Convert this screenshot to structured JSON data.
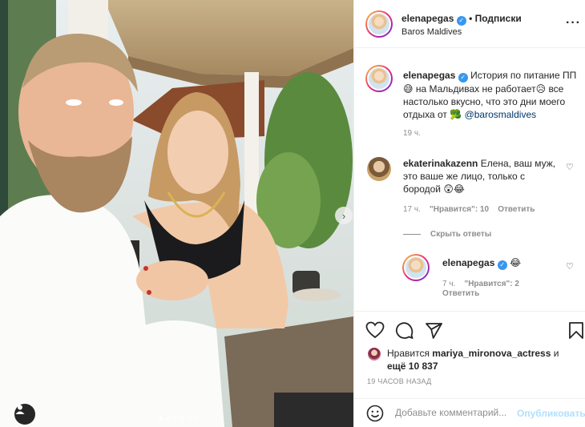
{
  "header": {
    "username": "elenapegas",
    "separator": "•",
    "follow_label": "Подписки",
    "location": "Baros Maldives",
    "more_icon": "more-horizontal-icon"
  },
  "caption": {
    "username": "elenapegas",
    "text_1": "История по питание ПП",
    "emoji_1": "😅",
    "text_2": "на Мальдивах не работает",
    "emoji_2": "😥",
    "text_3": "все настолько вкусно, что это дни моего отдыха от",
    "emoji_3": "🥦",
    "mention": "@barosmaldives",
    "time": "19 ч."
  },
  "comment": {
    "username": "ekaterinakazenn",
    "text_1": "Елена, ваш муж, это ваше же лицо, только с бородой",
    "emoji": "😲😂",
    "time": "17 ч.",
    "likes": "\"Нравится\": 10",
    "reply_label": "Ответить"
  },
  "hide_replies_label": "Скрыть ответы",
  "reply": {
    "username": "elenapegas",
    "emoji": "😂",
    "time": "7 ч.",
    "likes": "\"Нравится\": 2",
    "reply_label": "Ответить"
  },
  "likes_row": {
    "prefix": "Нравится",
    "user": "mariya_mironova_actress",
    "conjunction": "и",
    "more": "ещё 10 837"
  },
  "date": "19 ЧАСОВ НАЗАД",
  "add_comment": {
    "placeholder": "Добавьте комментарий...",
    "publish_label": "Опубликовать"
  },
  "carousel": {
    "count": 6,
    "active": 0
  },
  "colors": {
    "accent": "#0095f6",
    "verified": "#3897f0",
    "text": "#262626",
    "muted": "#8e8e8e"
  }
}
